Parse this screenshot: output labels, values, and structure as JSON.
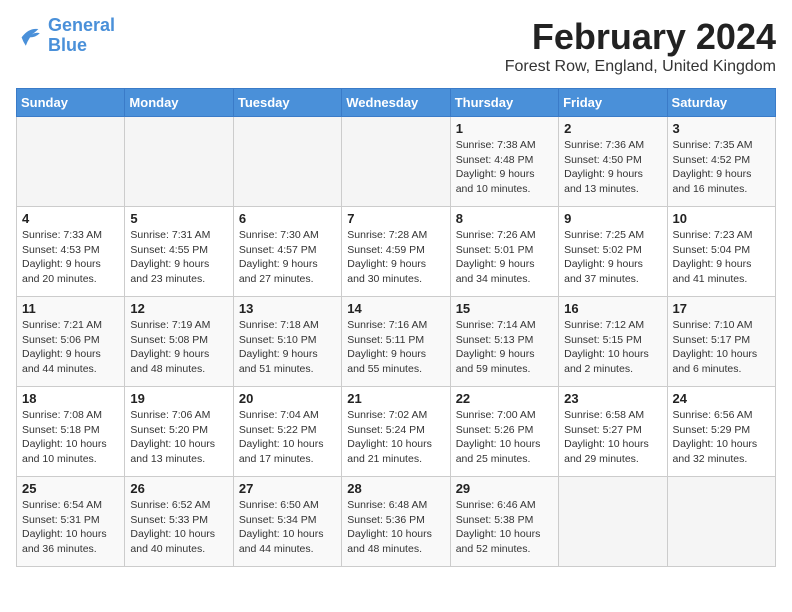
{
  "header": {
    "logo_line1": "General",
    "logo_line2": "Blue",
    "title": "February 2024",
    "subtitle": "Forest Row, England, United Kingdom"
  },
  "weekdays": [
    "Sunday",
    "Monday",
    "Tuesday",
    "Wednesday",
    "Thursday",
    "Friday",
    "Saturday"
  ],
  "weeks": [
    [
      {
        "day": "",
        "info": ""
      },
      {
        "day": "",
        "info": ""
      },
      {
        "day": "",
        "info": ""
      },
      {
        "day": "",
        "info": ""
      },
      {
        "day": "1",
        "info": "Sunrise: 7:38 AM\nSunset: 4:48 PM\nDaylight: 9 hours\nand 10 minutes."
      },
      {
        "day": "2",
        "info": "Sunrise: 7:36 AM\nSunset: 4:50 PM\nDaylight: 9 hours\nand 13 minutes."
      },
      {
        "day": "3",
        "info": "Sunrise: 7:35 AM\nSunset: 4:52 PM\nDaylight: 9 hours\nand 16 minutes."
      }
    ],
    [
      {
        "day": "4",
        "info": "Sunrise: 7:33 AM\nSunset: 4:53 PM\nDaylight: 9 hours\nand 20 minutes."
      },
      {
        "day": "5",
        "info": "Sunrise: 7:31 AM\nSunset: 4:55 PM\nDaylight: 9 hours\nand 23 minutes."
      },
      {
        "day": "6",
        "info": "Sunrise: 7:30 AM\nSunset: 4:57 PM\nDaylight: 9 hours\nand 27 minutes."
      },
      {
        "day": "7",
        "info": "Sunrise: 7:28 AM\nSunset: 4:59 PM\nDaylight: 9 hours\nand 30 minutes."
      },
      {
        "day": "8",
        "info": "Sunrise: 7:26 AM\nSunset: 5:01 PM\nDaylight: 9 hours\nand 34 minutes."
      },
      {
        "day": "9",
        "info": "Sunrise: 7:25 AM\nSunset: 5:02 PM\nDaylight: 9 hours\nand 37 minutes."
      },
      {
        "day": "10",
        "info": "Sunrise: 7:23 AM\nSunset: 5:04 PM\nDaylight: 9 hours\nand 41 minutes."
      }
    ],
    [
      {
        "day": "11",
        "info": "Sunrise: 7:21 AM\nSunset: 5:06 PM\nDaylight: 9 hours\nand 44 minutes."
      },
      {
        "day": "12",
        "info": "Sunrise: 7:19 AM\nSunset: 5:08 PM\nDaylight: 9 hours\nand 48 minutes."
      },
      {
        "day": "13",
        "info": "Sunrise: 7:18 AM\nSunset: 5:10 PM\nDaylight: 9 hours\nand 51 minutes."
      },
      {
        "day": "14",
        "info": "Sunrise: 7:16 AM\nSunset: 5:11 PM\nDaylight: 9 hours\nand 55 minutes."
      },
      {
        "day": "15",
        "info": "Sunrise: 7:14 AM\nSunset: 5:13 PM\nDaylight: 9 hours\nand 59 minutes."
      },
      {
        "day": "16",
        "info": "Sunrise: 7:12 AM\nSunset: 5:15 PM\nDaylight: 10 hours\nand 2 minutes."
      },
      {
        "day": "17",
        "info": "Sunrise: 7:10 AM\nSunset: 5:17 PM\nDaylight: 10 hours\nand 6 minutes."
      }
    ],
    [
      {
        "day": "18",
        "info": "Sunrise: 7:08 AM\nSunset: 5:18 PM\nDaylight: 10 hours\nand 10 minutes."
      },
      {
        "day": "19",
        "info": "Sunrise: 7:06 AM\nSunset: 5:20 PM\nDaylight: 10 hours\nand 13 minutes."
      },
      {
        "day": "20",
        "info": "Sunrise: 7:04 AM\nSunset: 5:22 PM\nDaylight: 10 hours\nand 17 minutes."
      },
      {
        "day": "21",
        "info": "Sunrise: 7:02 AM\nSunset: 5:24 PM\nDaylight: 10 hours\nand 21 minutes."
      },
      {
        "day": "22",
        "info": "Sunrise: 7:00 AM\nSunset: 5:26 PM\nDaylight: 10 hours\nand 25 minutes."
      },
      {
        "day": "23",
        "info": "Sunrise: 6:58 AM\nSunset: 5:27 PM\nDaylight: 10 hours\nand 29 minutes."
      },
      {
        "day": "24",
        "info": "Sunrise: 6:56 AM\nSunset: 5:29 PM\nDaylight: 10 hours\nand 32 minutes."
      }
    ],
    [
      {
        "day": "25",
        "info": "Sunrise: 6:54 AM\nSunset: 5:31 PM\nDaylight: 10 hours\nand 36 minutes."
      },
      {
        "day": "26",
        "info": "Sunrise: 6:52 AM\nSunset: 5:33 PM\nDaylight: 10 hours\nand 40 minutes."
      },
      {
        "day": "27",
        "info": "Sunrise: 6:50 AM\nSunset: 5:34 PM\nDaylight: 10 hours\nand 44 minutes."
      },
      {
        "day": "28",
        "info": "Sunrise: 6:48 AM\nSunset: 5:36 PM\nDaylight: 10 hours\nand 48 minutes."
      },
      {
        "day": "29",
        "info": "Sunrise: 6:46 AM\nSunset: 5:38 PM\nDaylight: 10 hours\nand 52 minutes."
      },
      {
        "day": "",
        "info": ""
      },
      {
        "day": "",
        "info": ""
      }
    ]
  ]
}
